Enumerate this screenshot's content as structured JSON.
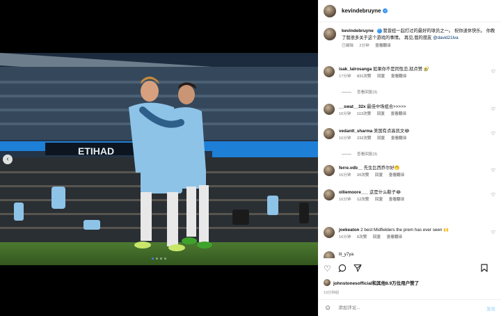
{
  "post": {
    "author": "kevindebruyne",
    "caption_author": "kevindebruyne",
    "caption_text": "我曾经一起打过的最好的球员之一。 祝你退休快乐。 你教了我很多关于这个游戏的事情。 再见,我的朋友",
    "caption_mention": "@david21lva",
    "caption_time": "已编辑",
    "caption_age": "2分钟",
    "see_translation": "查看翻译"
  },
  "comments": [
    {
      "user": "isak_lalrosanga",
      "text": "如果你不是同性恋,就点赞 🥑",
      "time": "17分钟",
      "likes": "831次赞",
      "reply": "回复",
      "translate": "查看翻译",
      "replies": "查看回复(3)"
    },
    {
      "user": "__swat__32x",
      "text": "最佳中场组合>>>>>",
      "time": "16分钟",
      "likes": "113次赞",
      "reply": "回复",
      "translate": "查看翻译",
      "replies": ""
    },
    {
      "user": "vedantt_sharma",
      "text": "美国有点高凯文😂",
      "time": "16分钟",
      "likes": "232次赞",
      "reply": "回复",
      "translate": "查看翻译",
      "replies": "查看回复(3)"
    },
    {
      "user": "ferre.vdb__",
      "text": "先生比西乔尔好🤭",
      "time": "16分钟",
      "likes": "20次赞",
      "reply": "回复",
      "translate": "查看翻译",
      "replies": ""
    },
    {
      "user": "olliemoore___",
      "text": "这是什么鞋子😂",
      "time": "16分钟",
      "likes": "12次赞",
      "reply": "回复",
      "translate": "查看翻译",
      "replies": ""
    },
    {
      "user": "joekeaton",
      "text": "2 best Midfielders the prem has ever seen 🙌",
      "time": "16分钟",
      "likes": "6次赞",
      "reply": "回复",
      "translate": "查看翻译",
      "replies": ""
    },
    {
      "user": "lil_y7ya",
      "text": "",
      "time": "",
      "likes": "",
      "reply": "",
      "translate": "",
      "replies": ""
    }
  ],
  "liked_by": "johnstonesofficial和其他8.9万位用户赞了",
  "date": "19分钟前",
  "add_comment_placeholder": "添加评论...",
  "post_button": "发布",
  "icons": [
    "heart-icon",
    "comment-icon",
    "share-icon",
    "bookmark-icon",
    "emoji-icon",
    "prev-arrow-icon",
    "verified-icon"
  ],
  "colors": {
    "verified": "#3897f0",
    "pitch": "#3f6b2a",
    "kit": "#8ec3e8",
    "dot_active": "#3b82f6"
  },
  "banner": "ETIHAD"
}
